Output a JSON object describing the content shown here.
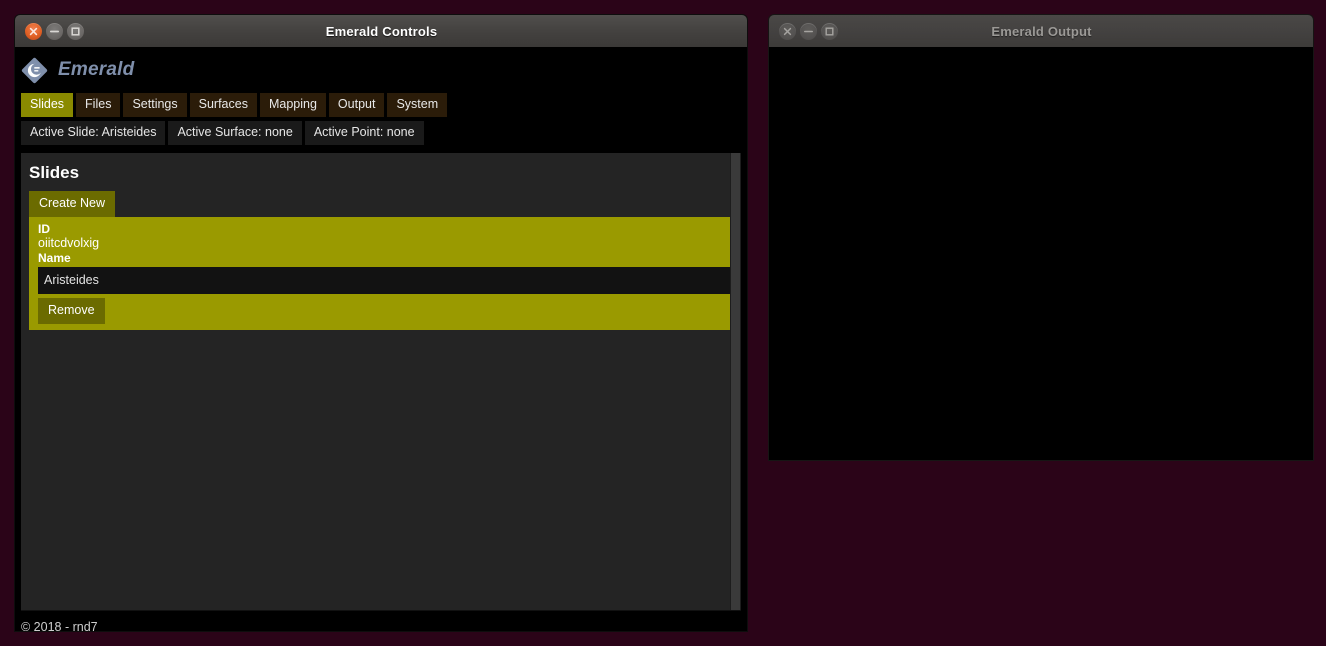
{
  "desktop": {
    "background_color": "#2b0418"
  },
  "controls_window": {
    "title": "Emerald Controls",
    "state": "active",
    "buttons": {
      "close": "close-icon",
      "minimize": "minimize-icon",
      "maximize": "maximize-icon"
    },
    "brand": {
      "name": "Emerald",
      "logo": "emerald-logo-icon",
      "color": "#7f8fab"
    },
    "tabs": [
      {
        "label": "Slides",
        "active": true
      },
      {
        "label": "Files",
        "active": false
      },
      {
        "label": "Settings",
        "active": false
      },
      {
        "label": "Surfaces",
        "active": false
      },
      {
        "label": "Mapping",
        "active": false
      },
      {
        "label": "Output",
        "active": false
      },
      {
        "label": "System",
        "active": false
      }
    ],
    "status_chips": [
      {
        "label": "Active Slide: Aristeides"
      },
      {
        "label": "Active Surface: none"
      },
      {
        "label": "Active Point: none"
      }
    ],
    "panel": {
      "title": "Slides",
      "create_button": "Create New",
      "record": {
        "id_label": "ID",
        "id_value": "oiitcdvolxig",
        "name_label": "Name",
        "name_value": "Aristeides",
        "name_placeholder": "",
        "remove_button": "Remove"
      },
      "accent_color": "#9a9a00",
      "button_color": "#6b6b00"
    },
    "footer": "© 2018 - rnd7"
  },
  "output_window": {
    "title": "Emerald Output",
    "state": "inactive",
    "buttons": {
      "close": "close-icon",
      "minimize": "minimize-icon",
      "maximize": "maximize-icon"
    },
    "content": ""
  }
}
